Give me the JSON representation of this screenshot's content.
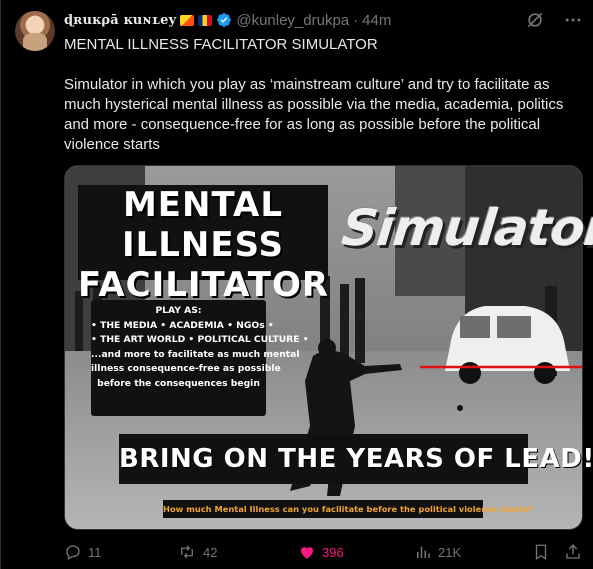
{
  "author": {
    "display_name": "ɖʀuĸρā ĸuɴʟey",
    "flags": [
      "bhutan-flag",
      "romania-flag"
    ],
    "verified": true,
    "handle": "@kunley_drukpa",
    "separator": "·",
    "time": "44m"
  },
  "tweet": {
    "headline": "MENTAL ILLNESS FACILITATOR SIMULATOR",
    "body": "Simulator in which you play as ‘mainstream culture’ and try to facilitate as much hysterical mental illness as possible via the media, academia, politics and more - consequence-free for as long as possible before the political violence starts"
  },
  "media": {
    "title_lines": [
      "MENTAL ILLNESS",
      "FACILITATOR"
    ],
    "sim_word": "Simulator",
    "play_as": [
      "PLAY AS:",
      "• THE MEDIA • ACADEMIA • NGOs •",
      "• THE ART WORLD • POLITICAL CULTURE •",
      "...and more to facilitate as much mental",
      "illness consequence-free as possible",
      "before the consequences begin"
    ],
    "banner": "BRING ON THE YEARS OF LEAD!",
    "question": "How much Mental Illness can you facilitate before the political violence starts?"
  },
  "actions": {
    "replies": "11",
    "reposts": "42",
    "likes": "396",
    "views": "21K"
  },
  "colors": {
    "like": "#f91880",
    "muted": "#71767b",
    "text": "#e7e9ea",
    "accent": "#1d9bf0"
  }
}
